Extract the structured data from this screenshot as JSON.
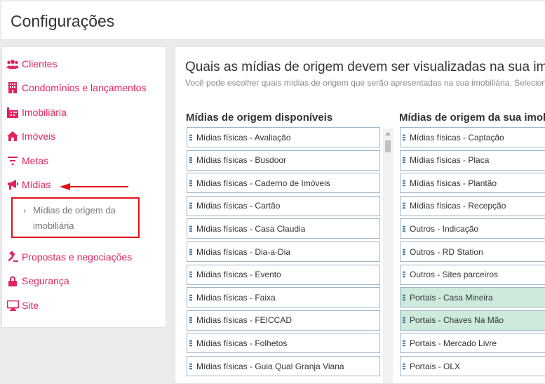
{
  "header": {
    "title": "Configurações"
  },
  "sidebar": {
    "items": [
      {
        "label": "Clientes",
        "icon": "users-icon"
      },
      {
        "label": "Condomínios e lançamentos",
        "icon": "building-icon"
      },
      {
        "label": "Imobiliária",
        "icon": "office-icon"
      },
      {
        "label": "Imóveis",
        "icon": "home-icon"
      },
      {
        "label": "Metas",
        "icon": "filter-icon"
      },
      {
        "label": "Mídias",
        "icon": "bullhorn-icon"
      },
      {
        "label": "Propostas e negociações",
        "icon": "gavel-icon"
      },
      {
        "label": "Segurança",
        "icon": "lock-icon"
      },
      {
        "label": "Site",
        "icon": "monitor-icon"
      }
    ],
    "subitem": {
      "label": "Mídias de origem da imobiliária"
    }
  },
  "main": {
    "title": "Quais as mídias de origem devem ser visualizadas na sua imobiliária?",
    "description": "Você pode escolher quais mídias de origem que serão apresentadas na sua imobiliária. Selecione e arraste para a lista da direita.",
    "available": {
      "title": "Mídias de origem disponíveis",
      "items": [
        "Mídias físicas - Avaliação",
        "Mídias físicas - Busdoor",
        "Mídias físicas - Caderno de Imóveis",
        "Mídias físicas - Cartão",
        "Mídias físicas - Casa Claudia",
        "Mídias físicas - Dia-a-Dia",
        "Mídias físicas - Evento",
        "Mídias físicas - Faixa",
        "Mídias físicas - FEICCAD",
        "Mídias físicas - Folhetos",
        "Mídias físicas - Guia Qual Granja Viana"
      ]
    },
    "selected": {
      "title": "Mídias de origem da sua imobiliária",
      "items": [
        {
          "label": "Mídias físicas - Captação",
          "highlight": false
        },
        {
          "label": "Mídias físicas - Placa",
          "highlight": false
        },
        {
          "label": "Mídias físicas - Plantão",
          "highlight": false
        },
        {
          "label": "Mídias físicas - Recepção",
          "highlight": false
        },
        {
          "label": "Outros - Indicação",
          "highlight": false
        },
        {
          "label": "Outros - RD Station",
          "highlight": false
        },
        {
          "label": "Outros - Sites parceiros",
          "highlight": false
        },
        {
          "label": "Portais - Casa Mineira",
          "highlight": true
        },
        {
          "label": "Portais - Chaves Na Mão",
          "highlight": true
        },
        {
          "label": "Portais - Mercado Livre",
          "highlight": false
        },
        {
          "label": "Portais - OLX",
          "highlight": false
        }
      ]
    }
  },
  "colors": {
    "accent": "#e0245e",
    "highlight_box": "#e01414",
    "item_border": "#9fb7c9",
    "item_highlight": "#cdeadd"
  }
}
